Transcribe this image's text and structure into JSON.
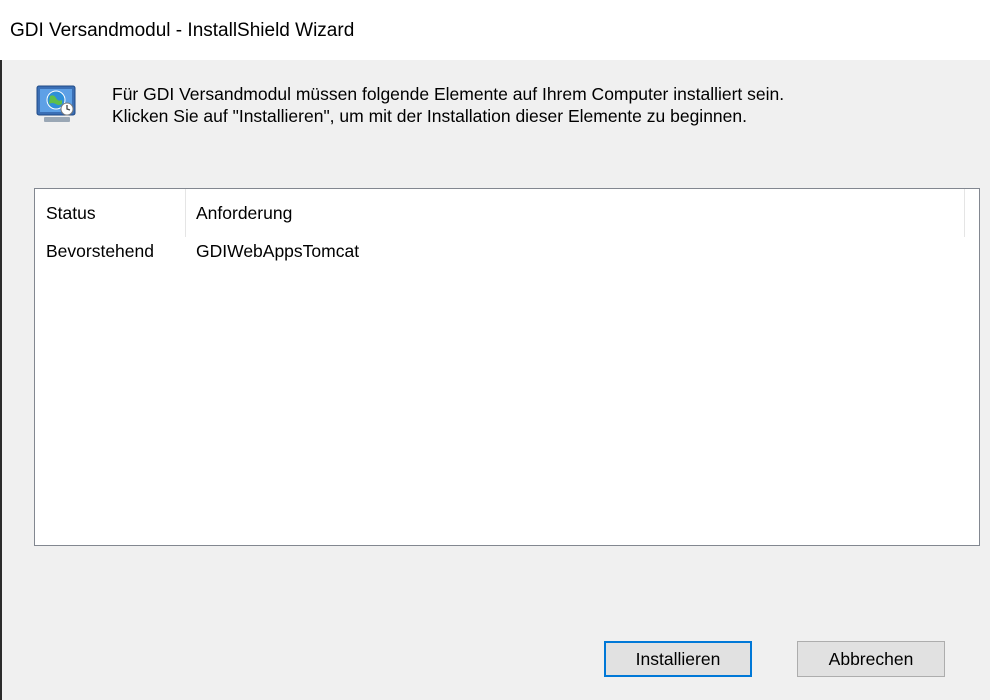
{
  "window": {
    "title": "GDI Versandmodul - InstallShield Wizard"
  },
  "message": {
    "line1": "Für GDI Versandmodul müssen folgende Elemente auf Ihrem Computer installiert sein.",
    "line2": "Klicken Sie auf \"Installieren\", um mit der Installation dieser Elemente zu beginnen.",
    "icon": "computer-globe-icon"
  },
  "requirements_list": {
    "columns": [
      "Status",
      "Anforderung"
    ],
    "rows": [
      {
        "status": "Bevorstehend",
        "requirement": "GDIWebAppsTomcat"
      }
    ]
  },
  "buttons": {
    "install_label": "Installieren",
    "cancel_label": "Abbrechen"
  },
  "colors": {
    "dialog_background": "#f0f0f0",
    "focus_border": "#0078d7",
    "button_face": "#e1e1e1"
  }
}
